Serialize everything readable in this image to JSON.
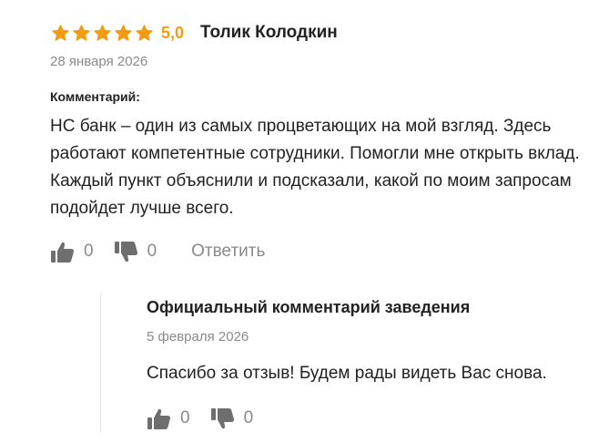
{
  "review": {
    "rating": 5,
    "rating_value": "5,0",
    "author": "Толик Колодкин",
    "date": "28 января 2026",
    "comment_label": "Комментарий:",
    "comment_text": "НС банк – один из самых процветающих на мой взгляд. Здесь работают компетентные сотрудники. Помогли мне открыть вклад. Каждый пункт объяснили и подсказали, какой по моим запросам подойдет лучше всего.",
    "likes": "0",
    "dislikes": "0",
    "reply_label": "Ответить"
  },
  "official_reply": {
    "title": "Официальный комментарий заведения",
    "date": "5 февраля 2026",
    "text": "Спасибо за отзыв! Будем рады видеть Вас снова.",
    "likes": "0",
    "dislikes": "0"
  },
  "colors": {
    "star": "#f39c12",
    "icon": "#6e6e6e",
    "muted_text": "#8a8a8a"
  }
}
